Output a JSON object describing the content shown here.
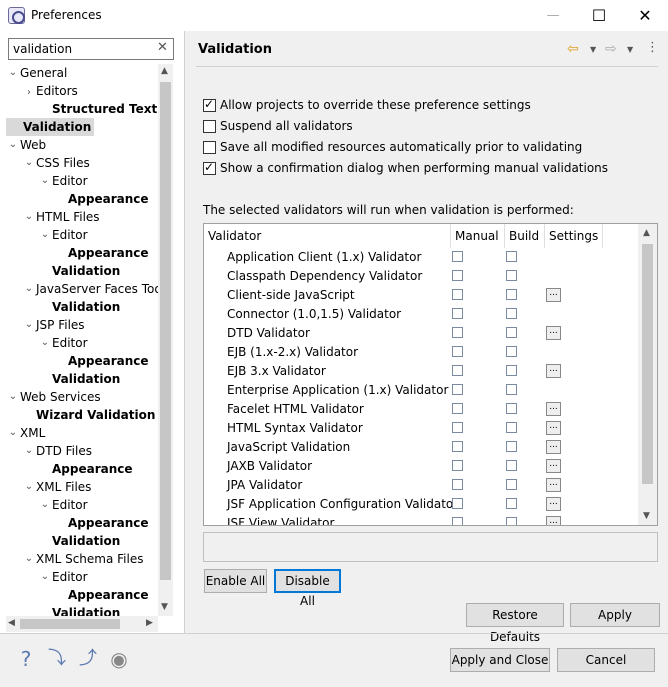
{
  "window": {
    "title": "Preferences",
    "help_glyph": "—",
    "max_glyph": "☐",
    "close_glyph": "✕"
  },
  "filter": {
    "value": "validation",
    "clear_glyph": "✕"
  },
  "tree": [
    {
      "label": "General",
      "level": 0,
      "twisty": "v",
      "bold": false
    },
    {
      "label": "Editors",
      "level": 1,
      "twisty": ">",
      "bold": false
    },
    {
      "label": "Structured Text",
      "level": 2,
      "twisty": "",
      "bold": true
    },
    {
      "label": "Validation",
      "level": 0,
      "twisty": "",
      "bold": true,
      "selected": true
    },
    {
      "label": "Web",
      "level": 0,
      "twisty": "v",
      "bold": false
    },
    {
      "label": "CSS Files",
      "level": 1,
      "twisty": "v",
      "bold": false
    },
    {
      "label": "Editor",
      "level": 2,
      "twisty": "v",
      "bold": false
    },
    {
      "label": "Appearance",
      "level": 3,
      "twisty": "",
      "bold": true
    },
    {
      "label": "HTML Files",
      "level": 1,
      "twisty": "v",
      "bold": false
    },
    {
      "label": "Editor",
      "level": 2,
      "twisty": "v",
      "bold": false
    },
    {
      "label": "Appearance",
      "level": 3,
      "twisty": "",
      "bold": true
    },
    {
      "label": "Validation",
      "level": 2,
      "twisty": "",
      "bold": true
    },
    {
      "label": "JavaServer Faces Too",
      "level": 1,
      "twisty": "v",
      "bold": false
    },
    {
      "label": "Validation",
      "level": 2,
      "twisty": "",
      "bold": true
    },
    {
      "label": "JSP Files",
      "level": 1,
      "twisty": "v",
      "bold": false
    },
    {
      "label": "Editor",
      "level": 2,
      "twisty": "v",
      "bold": false
    },
    {
      "label": "Appearance",
      "level": 3,
      "twisty": "",
      "bold": true
    },
    {
      "label": "Validation",
      "level": 2,
      "twisty": "",
      "bold": true
    },
    {
      "label": "Web Services",
      "level": 0,
      "twisty": "v",
      "bold": false
    },
    {
      "label": "Wizard Validation",
      "level": 1,
      "twisty": "",
      "bold": true
    },
    {
      "label": "XML",
      "level": 0,
      "twisty": "v",
      "bold": false
    },
    {
      "label": "DTD Files",
      "level": 1,
      "twisty": "v",
      "bold": false
    },
    {
      "label": "Appearance",
      "level": 2,
      "twisty": "",
      "bold": true
    },
    {
      "label": "XML Files",
      "level": 1,
      "twisty": "v",
      "bold": false
    },
    {
      "label": "Editor",
      "level": 2,
      "twisty": "v",
      "bold": false
    },
    {
      "label": "Appearance",
      "level": 3,
      "twisty": "",
      "bold": true
    },
    {
      "label": "Validation",
      "level": 2,
      "twisty": "",
      "bold": true
    },
    {
      "label": "XML Schema Files",
      "level": 1,
      "twisty": "v",
      "bold": false
    },
    {
      "label": "Editor",
      "level": 2,
      "twisty": "v",
      "bold": false
    },
    {
      "label": "Appearance",
      "level": 3,
      "twisty": "",
      "bold": true
    },
    {
      "label": "Validation",
      "level": 2,
      "twisty": "",
      "bold": true
    }
  ],
  "page": {
    "title": "Validation",
    "options": [
      {
        "label": "Allow projects to override these preference settings",
        "checked": true
      },
      {
        "label": "Suspend all validators",
        "checked": false
      },
      {
        "label": "Save all modified resources automatically prior to validating",
        "checked": false
      },
      {
        "label": "Show a confirmation dialog when performing manual validations",
        "checked": true
      }
    ],
    "note": "The selected validators will run when validation is performed:",
    "columns": [
      "Validator",
      "Manual",
      "Build",
      "Settings"
    ],
    "validators": [
      {
        "name": "Application Client (1.x) Validator",
        "settings": false
      },
      {
        "name": "Classpath Dependency Validator",
        "settings": false
      },
      {
        "name": "Client-side JavaScript",
        "settings": true
      },
      {
        "name": "Connector (1.0,1.5) Validator",
        "settings": false
      },
      {
        "name": "DTD Validator",
        "settings": true
      },
      {
        "name": "EJB (1.x-2.x) Validator",
        "settings": false
      },
      {
        "name": "EJB 3.x Validator",
        "settings": true
      },
      {
        "name": "Enterprise Application (1.x) Validator",
        "settings": false
      },
      {
        "name": "Facelet HTML Validator",
        "settings": true
      },
      {
        "name": "HTML Syntax Validator",
        "settings": true
      },
      {
        "name": "JavaScript Validation",
        "settings": true
      },
      {
        "name": "JAXB Validator",
        "settings": true
      },
      {
        "name": "JPA Validator",
        "settings": true
      },
      {
        "name": "JSF Application Configuration Validator",
        "settings": true
      },
      {
        "name": "JSF View Validator",
        "settings": true
      }
    ],
    "settings_glyph": "...",
    "enable_all": "Enable All",
    "disable_all": "Disable All",
    "restore_defaults": "Restore Defaults",
    "apply": "Apply"
  },
  "footer": {
    "apply_close": "Apply and Close",
    "cancel": "Cancel",
    "icons": [
      "help-icon",
      "import-icon",
      "export-icon",
      "record-icon"
    ]
  }
}
